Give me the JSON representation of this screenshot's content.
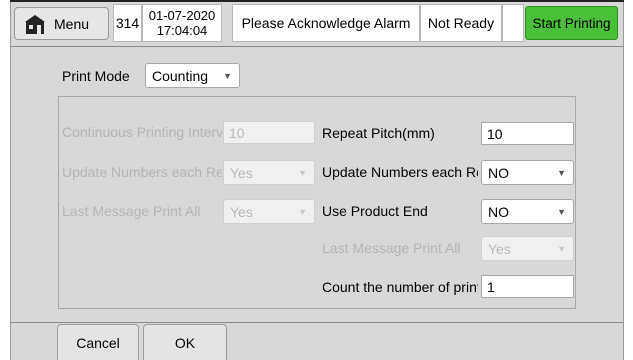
{
  "header": {
    "menu_label": "Menu",
    "count": "314",
    "date": "01-07-2020",
    "time": "17:04:04",
    "alarm": "Please Acknowledge Alarm",
    "status": "Not Ready",
    "start_label": "Start Printing",
    "start_color": "#4cbf3a"
  },
  "print_mode": {
    "label": "Print Mode",
    "value": "Counting"
  },
  "left_fields": [
    {
      "label": "Continuous Printing Interv",
      "value": "10"
    },
    {
      "label": "Update Numbers each Re",
      "value": "Yes"
    },
    {
      "label": "Last Message Print All",
      "value": "Yes"
    }
  ],
  "right_fields": [
    {
      "label": "Repeat Pitch(mm)",
      "value": "10"
    },
    {
      "label": "Update Numbers each Re",
      "value": "NO"
    },
    {
      "label": "Use Product End",
      "value": "NO"
    },
    {
      "label": "Last Message Print All",
      "value": "Yes"
    },
    {
      "label": "Count the number of print",
      "value": "1"
    }
  ],
  "footer": {
    "cancel_label": "Cancel",
    "ok_label": "OK"
  }
}
